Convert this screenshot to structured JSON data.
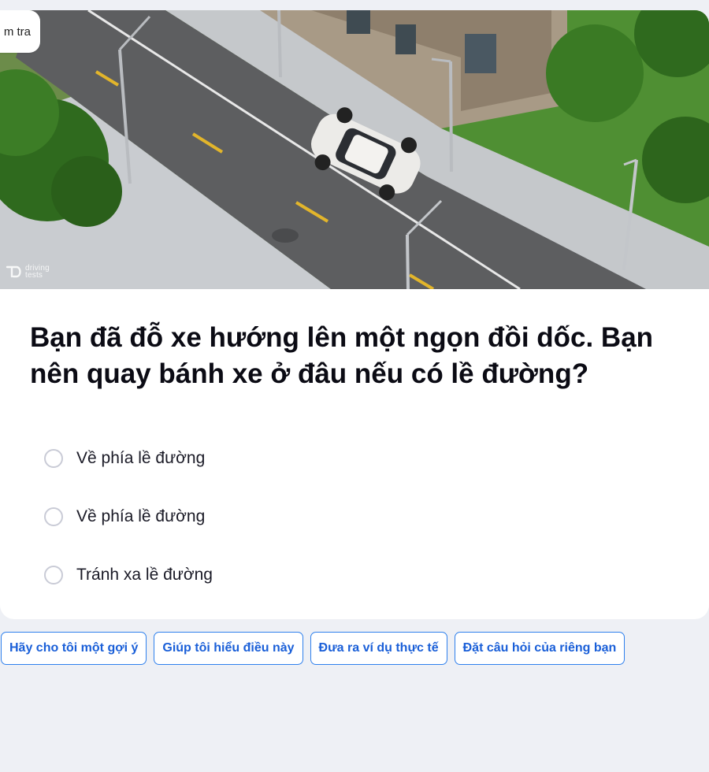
{
  "tag": {
    "label": "m tra"
  },
  "image": {
    "watermark_top": "driving",
    "watermark_bottom": "tests"
  },
  "question": {
    "text": "Bạn đã đỗ xe hướng lên một ngọn đồi dốc. Bạn nên quay bánh xe ở đâu nếu có lề đường?"
  },
  "options": [
    {
      "label": "Về phía lề đường"
    },
    {
      "label": "Về phía lề đường"
    },
    {
      "label": "Tránh xa lề đường"
    }
  ],
  "help_chips": [
    {
      "label": "Hãy cho tôi một gợi ý"
    },
    {
      "label": "Giúp tôi hiểu điều này"
    },
    {
      "label": "Đưa ra ví dụ thực tế"
    },
    {
      "label": "Đặt câu hỏi của riêng bạn"
    }
  ],
  "colors": {
    "accent": "#2f80ed",
    "page_background": "#eef0f5",
    "card_background": "#ffffff"
  }
}
